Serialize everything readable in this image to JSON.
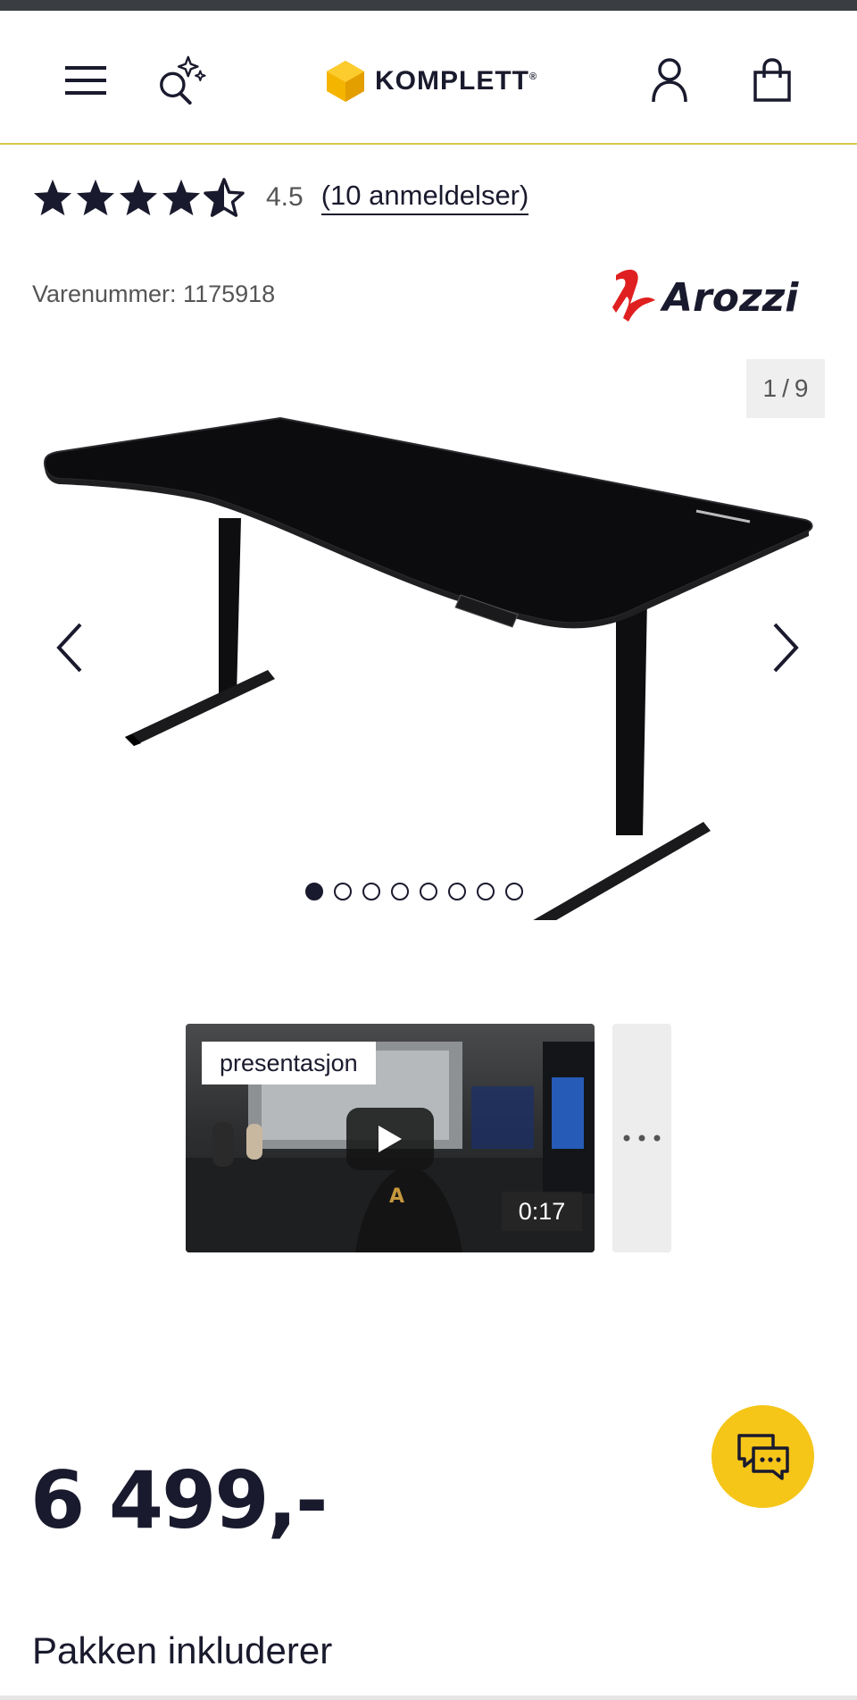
{
  "header": {
    "brand_name": "KOMPLETT",
    "brand_mark": "®",
    "icons": [
      "menu-icon",
      "ai-search-icon",
      "user-icon",
      "shopping-bag-icon"
    ]
  },
  "product": {
    "rating_value": "4.5",
    "rating_stars": 4.5,
    "rating_max": 5,
    "reviews_link": "(10 anmeldelser)",
    "sku_label": "Varenummer: 1175918",
    "brand_logo_text": "Arozzi",
    "price": "6 499,-",
    "package_title": "Pakken inkluderer"
  },
  "gallery": {
    "current": "1",
    "separator": "/",
    "total": "9",
    "dot_count": 8,
    "active_dot": 0
  },
  "video": {
    "label": "presentasjon",
    "duration": "0:17"
  },
  "colors": {
    "accent": "#f5c518",
    "header_border": "#d8c84a",
    "text_dark": "#1a1a2e",
    "brand_red": "#e02020"
  }
}
